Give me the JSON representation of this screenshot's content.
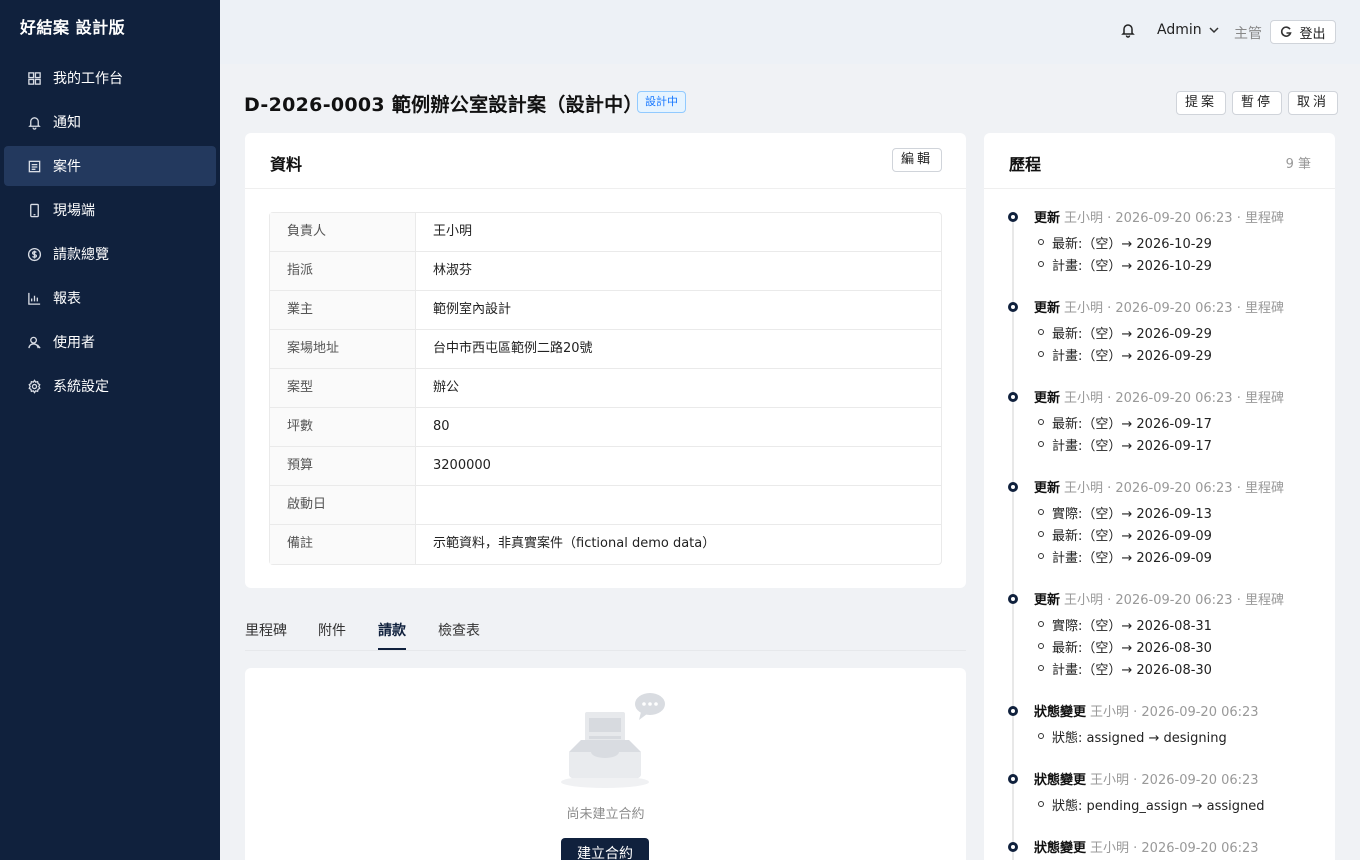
{
  "brand": "好結案 設計版",
  "nav": [
    {
      "label": "我的工作台",
      "icon": "dashboard-icon"
    },
    {
      "label": "通知",
      "icon": "bell-icon"
    },
    {
      "label": "案件",
      "icon": "case-icon",
      "active": true
    },
    {
      "label": "現場端",
      "icon": "mobile-icon"
    },
    {
      "label": "請款總覽",
      "icon": "dollar-icon"
    },
    {
      "label": "報表",
      "icon": "chart-icon"
    },
    {
      "label": "使用者",
      "icon": "user-icon"
    },
    {
      "label": "系統設定",
      "icon": "gear-icon"
    }
  ],
  "header": {
    "user": "Admin",
    "role": "主管",
    "logout": "登出"
  },
  "title": "D-2026-0003 範例辦公室設計案（設計中）",
  "status_tag": "設計中",
  "actions": {
    "submit": "提案",
    "pause": "暫停",
    "cancel": "取消"
  },
  "info": {
    "title": "資料",
    "edit": "編輯",
    "rows": [
      {
        "label": "負責人",
        "value": "王小明"
      },
      {
        "label": "指派",
        "value": "林淑芬"
      },
      {
        "label": "業主",
        "value": "範例室內設計"
      },
      {
        "label": "案場地址",
        "value": "台中市西屯區範例二路20號"
      },
      {
        "label": "案型",
        "value": "辦公"
      },
      {
        "label": "坪數",
        "value": "80"
      },
      {
        "label": "預算",
        "value": "3200000"
      },
      {
        "label": "啟動日",
        "value": ""
      },
      {
        "label": "備註",
        "value": "示範資料，非真實案件（fictional demo data）"
      }
    ]
  },
  "tabs": [
    "里程碑",
    "附件",
    "請款",
    "檢查表"
  ],
  "active_tab": "請款",
  "empty": {
    "text": "尚未建立合約",
    "button": "建立合約"
  },
  "history": {
    "title": "歷程",
    "count": "9 筆",
    "items": [
      {
        "type": "更新",
        "meta": "王小明 · 2026-09-20 06:23 · 里程碑",
        "changes": [
          "最新:（空）→ 2026-10-29",
          "計畫:（空）→ 2026-10-29"
        ]
      },
      {
        "type": "更新",
        "meta": "王小明 · 2026-09-20 06:23 · 里程碑",
        "changes": [
          "最新:（空）→ 2026-09-29",
          "計畫:（空）→ 2026-09-29"
        ]
      },
      {
        "type": "更新",
        "meta": "王小明 · 2026-09-20 06:23 · 里程碑",
        "changes": [
          "最新:（空）→ 2026-09-17",
          "計畫:（空）→ 2026-09-17"
        ]
      },
      {
        "type": "更新",
        "meta": "王小明 · 2026-09-20 06:23 · 里程碑",
        "changes": [
          "實際:（空）→ 2026-09-13",
          "最新:（空）→ 2026-09-09",
          "計畫:（空）→ 2026-09-09"
        ]
      },
      {
        "type": "更新",
        "meta": "王小明 · 2026-09-20 06:23 · 里程碑",
        "changes": [
          "實際:（空）→ 2026-08-31",
          "最新:（空）→ 2026-08-30",
          "計畫:（空）→ 2026-08-30"
        ]
      },
      {
        "type": "狀態變更",
        "meta": "王小明 · 2026-09-20 06:23",
        "changes": [
          "狀態: assigned → designing"
        ]
      },
      {
        "type": "狀態變更",
        "meta": "王小明 · 2026-09-20 06:23",
        "changes": [
          "狀態: pending_assign → assigned"
        ]
      },
      {
        "type": "狀態變更",
        "meta": "王小明 · 2026-09-20 06:23",
        "changes": []
      }
    ]
  }
}
